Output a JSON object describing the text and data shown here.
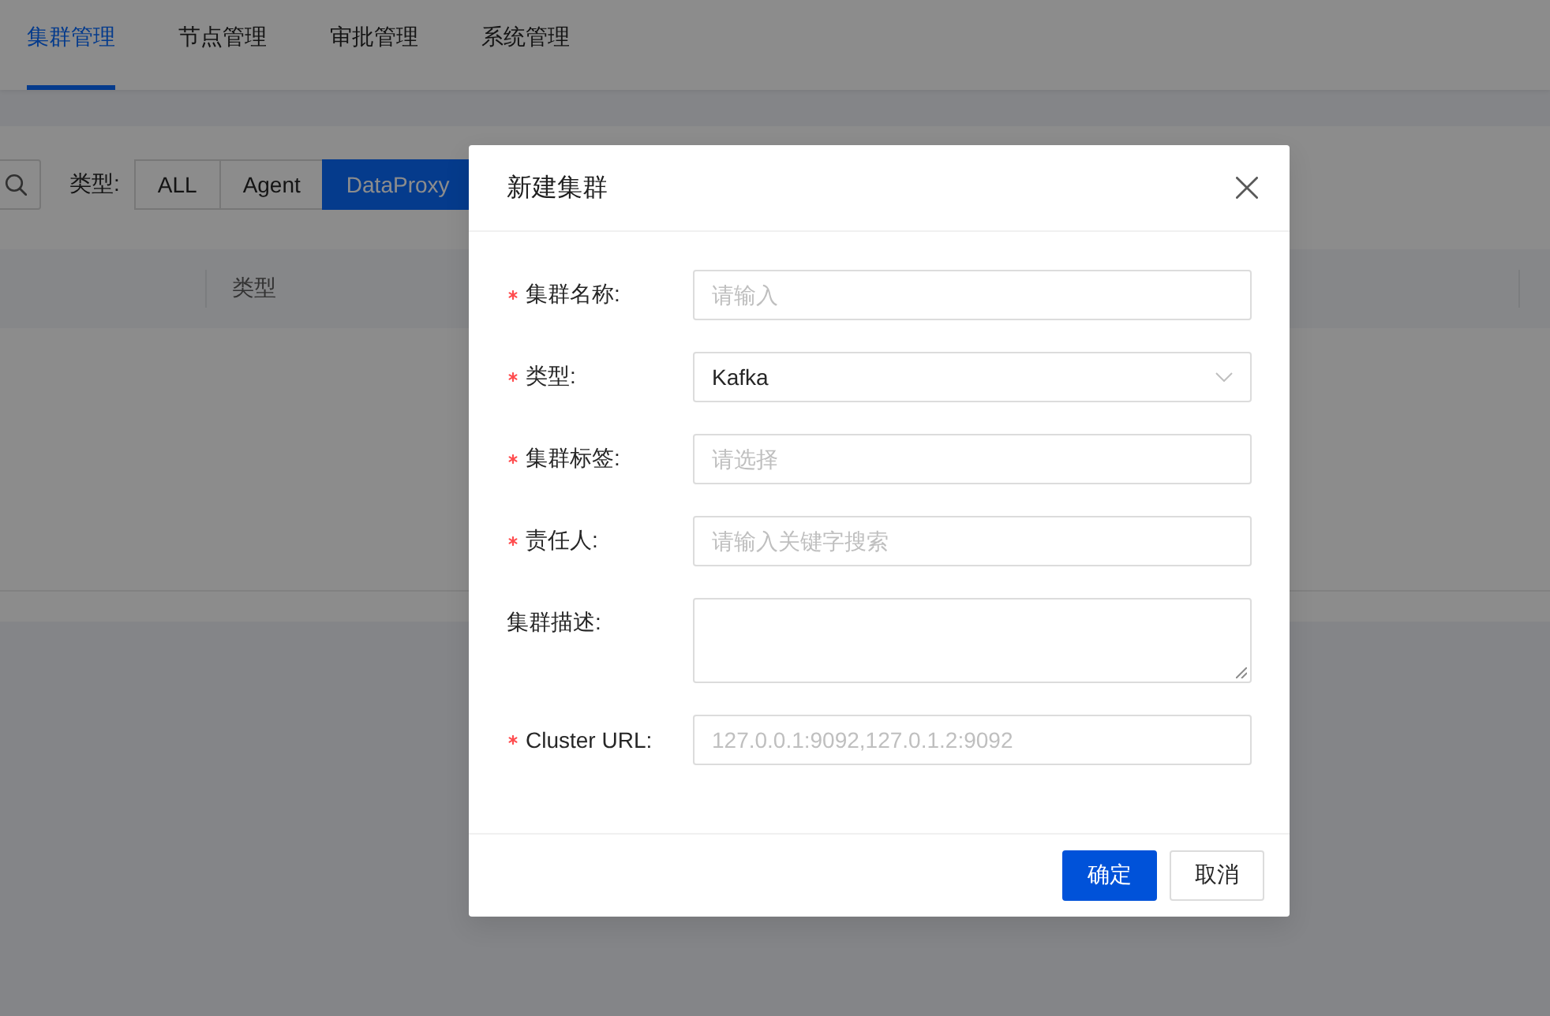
{
  "nav": {
    "tabs": [
      {
        "label": "集群管理",
        "selected": true
      },
      {
        "label": "节点管理",
        "selected": false
      },
      {
        "label": "审批管理",
        "selected": false
      },
      {
        "label": "系统管理",
        "selected": false
      }
    ]
  },
  "filter": {
    "label": "类型:",
    "options": [
      {
        "label": "ALL",
        "selected": false
      },
      {
        "label": "Agent",
        "selected": false
      },
      {
        "label": "DataProxy",
        "selected": true
      }
    ]
  },
  "table": {
    "columns": [
      "类型"
    ]
  },
  "dialog": {
    "title": "新建集群",
    "fields": [
      {
        "label": "集群名称:",
        "required": true,
        "kind": "input",
        "placeholder": "请输入"
      },
      {
        "label": "类型:",
        "required": true,
        "kind": "select",
        "value": "Kafka"
      },
      {
        "label": "集群标签:",
        "required": true,
        "kind": "input",
        "placeholder": "请选择"
      },
      {
        "label": "责任人:",
        "required": true,
        "kind": "input",
        "placeholder": "请输入关键字搜索"
      },
      {
        "label": "集群描述:",
        "required": false,
        "kind": "textarea"
      },
      {
        "label": "Cluster URL:",
        "required": true,
        "kind": "input",
        "placeholder": "127.0.0.1:9092,127.0.1.2:9092"
      }
    ],
    "buttons": [
      {
        "label": "确定",
        "kind": "primary"
      },
      {
        "label": "取消",
        "kind": "default"
      }
    ]
  }
}
